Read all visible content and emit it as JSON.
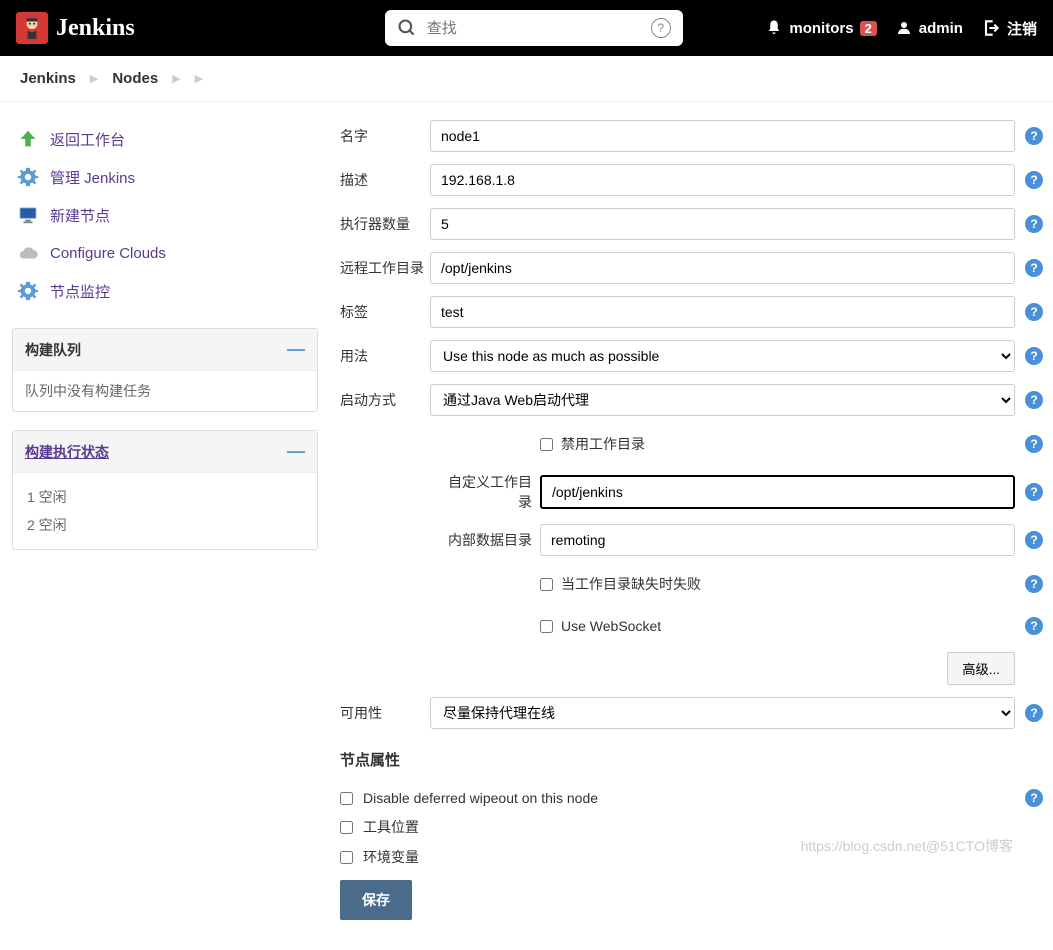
{
  "header": {
    "brand": "Jenkins",
    "search_placeholder": "查找",
    "monitors_label": "monitors",
    "monitors_count": "2",
    "user": "admin",
    "logout": "注销"
  },
  "breadcrumb": {
    "items": [
      "Jenkins",
      "Nodes"
    ]
  },
  "sidebar": {
    "links": [
      {
        "label": "返回工作台",
        "icon": "up-arrow",
        "color": "#4caf50"
      },
      {
        "label": "管理 Jenkins",
        "icon": "gear",
        "color": "#5a9bd5"
      },
      {
        "label": "新建节点",
        "icon": "monitor",
        "color": "#666"
      },
      {
        "label": "Configure Clouds",
        "icon": "cloud",
        "color": "#aaa"
      },
      {
        "label": "节点监控",
        "icon": "gear",
        "color": "#5a9bd5"
      }
    ],
    "queue": {
      "title": "构建队列",
      "empty": "队列中没有构建任务"
    },
    "exec": {
      "title": "构建执行状态",
      "items": [
        "1  空闲",
        "2  空闲"
      ]
    }
  },
  "form": {
    "labels": {
      "name": "名字",
      "desc": "描述",
      "executors": "执行器数量",
      "remote": "远程工作目录",
      "labels_field": "标签",
      "usage": "用法",
      "launch": "启动方式",
      "disable_workdir": "禁用工作目录",
      "custom_workdir": "自定义工作目录",
      "internal_data": "内部数据目录",
      "fail_missing": "当工作目录缺失时失败",
      "use_websocket": "Use WebSocket",
      "advanced": "高级...",
      "availability": "可用性",
      "node_props": "节点属性",
      "disable_wipeout": "Disable deferred wipeout on this node",
      "tool_location": "工具位置",
      "env_vars": "环境变量",
      "save": "保存"
    },
    "values": {
      "name": "node1",
      "desc": "192.168.1.8",
      "executors": "5",
      "remote": "/opt/jenkins",
      "labels_field": "test",
      "usage": "Use this node as much as possible",
      "launch": "通过Java Web启动代理",
      "custom_workdir_prefix": "/opt/",
      "custom_workdir_highlight": "jenkins",
      "internal_data": "remoting",
      "availability": "尽量保持代理在线"
    }
  },
  "watermark": "https://blog.csdn.net@51CTO博客"
}
